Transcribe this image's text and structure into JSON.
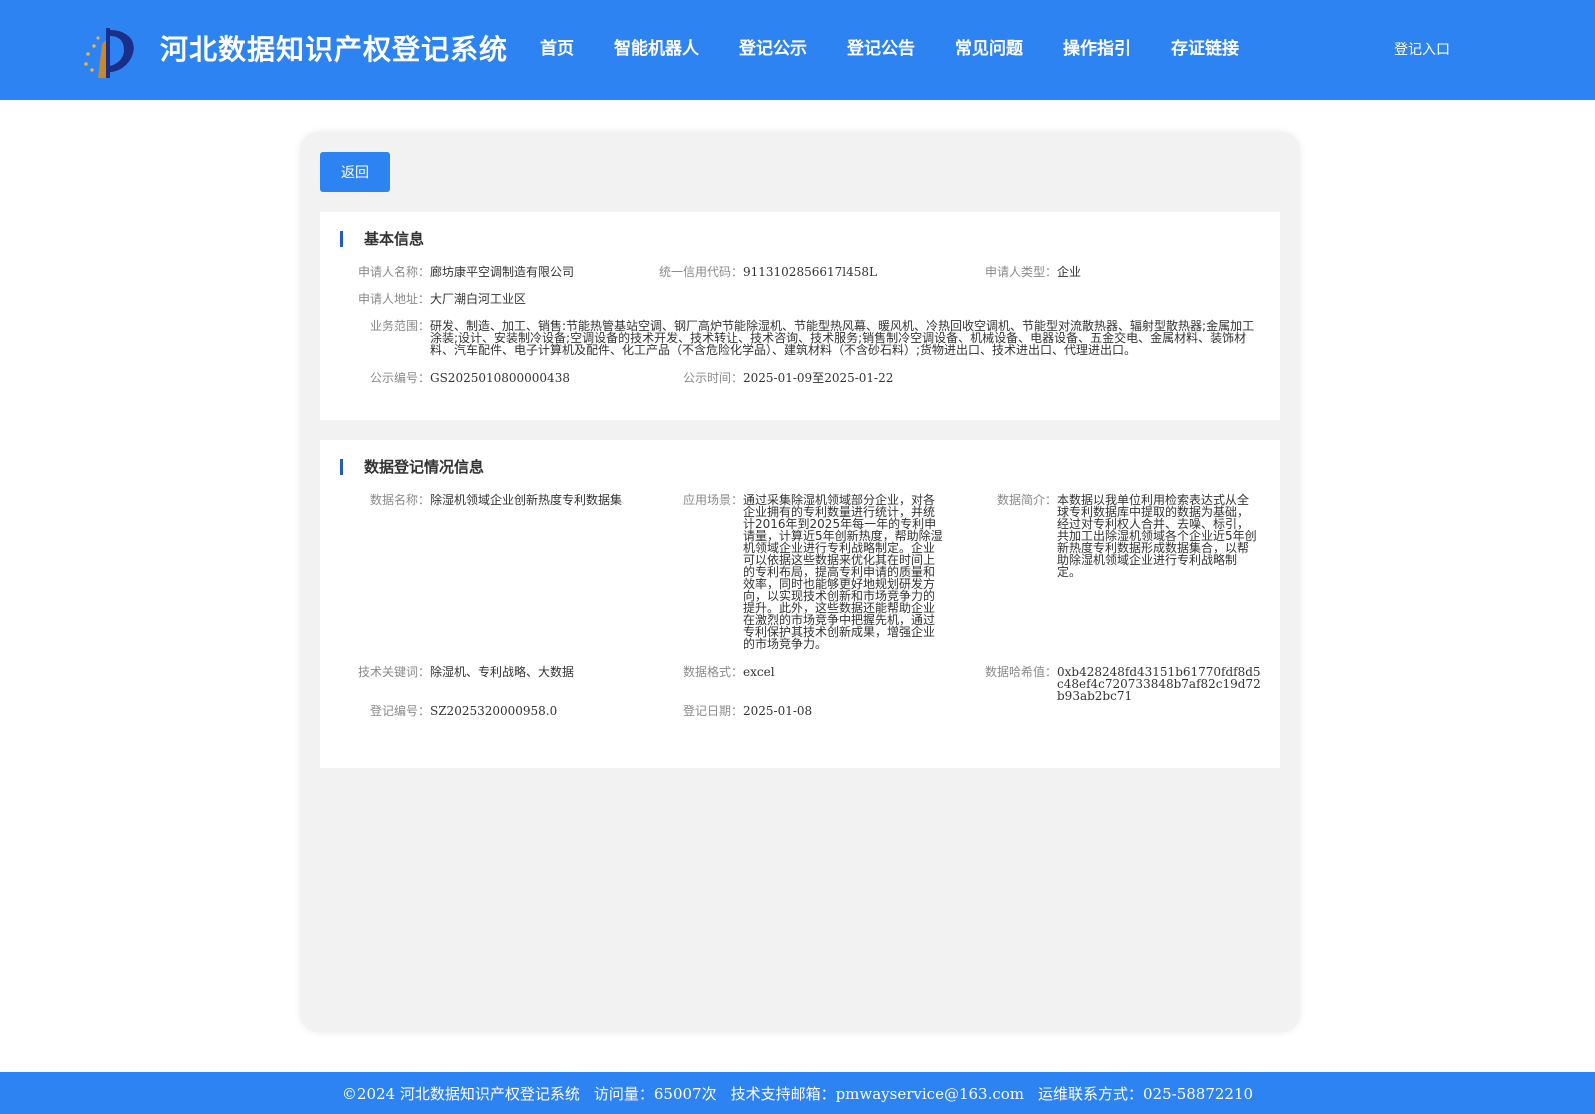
{
  "header": {
    "site_title": "河北数据知识产权登记系统",
    "nav": [
      "首页",
      "智能机器人",
      "登记公示",
      "登记公告",
      "常见问题",
      "操作指引",
      "存证链接"
    ],
    "login": "登记入口",
    "brand_color": "#2d83f1"
  },
  "toolbar": {
    "back_label": "返回"
  },
  "basic_info": {
    "title": "基本信息",
    "applicant_name": {
      "label": "申请人名称：",
      "value": "廊坊康平空调制造有限公司"
    },
    "credit_code": {
      "label": "统一信用代码：",
      "value": "9113102856617l458L"
    },
    "applicant_type": {
      "label": "申请人类型：",
      "value": "企业"
    },
    "address": {
      "label": "申请人地址：",
      "value": "大厂潮白河工业区"
    },
    "business_scope": {
      "label": "业务范围：",
      "value": "研发、制造、加工、销售:节能热管基站空调、钢厂高炉节能除湿机、节能型热风幕、暖风机、冷热回收空调机、节能型对流散热器、辐射型散热器;金属加工涂装;设计、安装制冷设备;空调设备的技术开发、技术转让、技术咨询、技术服务;销售制冷空调设备、机械设备、电器设备、五金交电、金属材料、装饰材料、汽车配件、电子计算机及配件、化工产品（不含危险化学品）、建筑材料（不含砂石料）;货物进出口、技术进出口、代理进出口。"
    },
    "notice_no": {
      "label": "公示编号：",
      "value": "GS2025010800000438"
    },
    "notice_time": {
      "label": "公示时间：",
      "value": "2025-01-09至2025-01-22"
    }
  },
  "data_info": {
    "title": "数据登记情况信息",
    "data_name": {
      "label": "数据名称：",
      "value": "除湿机领域企业创新热度专利数据集"
    },
    "scenario": {
      "label": "应用场景：",
      "value": "通过采集除湿机领域部分企业，对各企业拥有的专利数量进行统计，并统计2016年到2025年每一年的专利申请量，计算近5年创新热度，帮助除湿机领域企业进行专利战略制定。企业可以依据这些数据来优化其在时间上的专利布局，提高专利申请的质量和效率，同时也能够更好地规划研发方向，以实现技术创新和市场竞争力的提升。此外，这些数据还能帮助企业在激烈的市场竞争中把握先机，通过专利保护其技术创新成果，增强企业的市场竞争力。"
    },
    "summary": {
      "label": "数据简介：",
      "value": "本数据以我单位利用检索表达式从全球专利数据库中提取的数据为基础，经过对专利权人合并、去噪、标引，共加工出除湿机领域各个企业近5年创新热度专利数据形成数据集合，以帮助除湿机领域企业进行专利战略制定。"
    },
    "keywords": {
      "label": "技术关键词：",
      "value": "除湿机、专利战略、大数据"
    },
    "format": {
      "label": "数据格式：",
      "value": "excel"
    },
    "hash": {
      "label": "数据哈希值：",
      "value": "0xb428248fd43151b61770fdf8d5c48ef4c720733848b7af82c19d72b93ab2bc71"
    },
    "reg_no": {
      "label": "登记编号：",
      "value": "SZ2025320000958.0"
    },
    "reg_date": {
      "label": "登记日期：",
      "value": "2025-01-08"
    }
  },
  "footer": {
    "copyright": "©2024 河北数据知识产权登记系统",
    "visits": "访问量：65007次",
    "email": "技术支持邮箱：pmwayservice@163.com",
    "contact": "运维联系方式：025-58872210"
  }
}
